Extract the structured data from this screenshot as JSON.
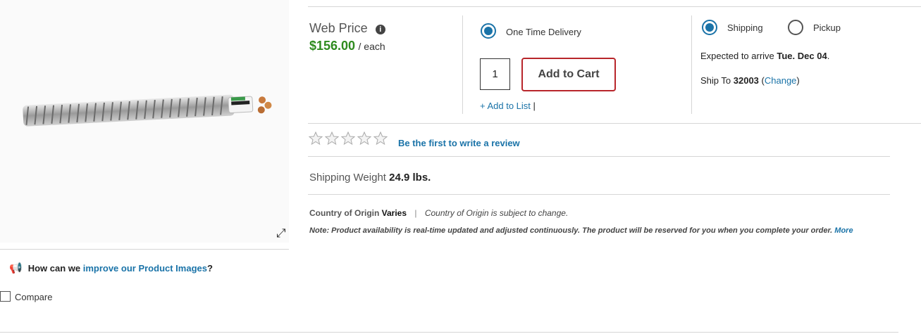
{
  "price": {
    "label": "Web Price",
    "amount": "$156.00",
    "unit": "/ each"
  },
  "delivery": {
    "option_label": "One Time Delivery",
    "quantity": "1",
    "add_to_cart": "Add to Cart",
    "add_to_list": "+ Add to List",
    "list_sep": "|"
  },
  "fulfillment": {
    "shipping_label": "Shipping",
    "pickup_label": "Pickup",
    "arrive_prefix": "Expected to arrive ",
    "arrive_date": "Tue. Dec 04",
    "arrive_suffix": ".",
    "ship_to_prefix": "Ship To ",
    "ship_zip": "32003",
    "change_open": " (",
    "change_link": "Change",
    "change_close": ")"
  },
  "reviews": {
    "link": "Be the first to write a review",
    "rating": 0,
    "max": 5
  },
  "weight": {
    "label": "Shipping Weight ",
    "value": "24.9 lbs."
  },
  "origin": {
    "label": "Country of Origin ",
    "value": "Varies",
    "sep": "|",
    "note": "Country of Origin is subject to change."
  },
  "note": {
    "text": "Note: Product availability is real-time updated and adjusted continuously. The product will be reserved for you when you complete your order. ",
    "more": "More"
  },
  "feedback": {
    "prefix": "How can we ",
    "link": "improve our Product Images",
    "suffix": "?"
  },
  "compare": {
    "label": "Compare"
  },
  "colors": {
    "accent": "#1a73a8",
    "price": "#2e8b1e",
    "cart_border": "#b8262b"
  }
}
